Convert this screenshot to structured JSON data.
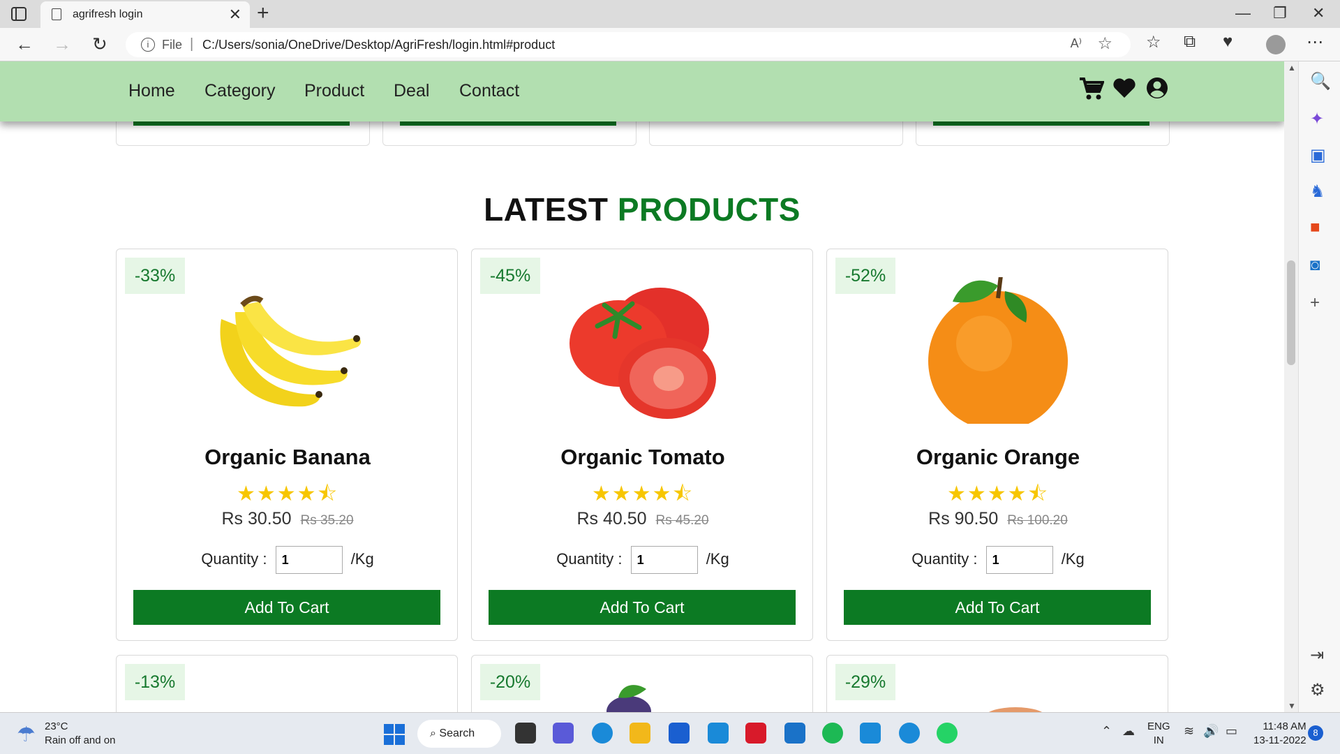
{
  "browser": {
    "tab_title": "agrifresh login",
    "url_scheme": "File",
    "url_path": "C:/Users/sonia/OneDrive/Desktop/AgriFresh/login.html#product"
  },
  "header": {
    "menu": [
      "Home",
      "Category",
      "Product",
      "Deal",
      "Contact"
    ],
    "icons": [
      "cart-icon",
      "heart-icon",
      "user-icon"
    ]
  },
  "section": {
    "title_dark": "LATEST",
    "title_green": "PRODUCTS"
  },
  "products": [
    {
      "name": "Organic Banana",
      "discount": "-33%",
      "price": "Rs 30.50",
      "old_price": "Rs 35.20",
      "rating": 4.5,
      "stars": "★★★★⯪",
      "qty_label": "Quantity :",
      "qty": "1",
      "unit": "/Kg",
      "button": "Add To Cart",
      "image": "banana-image"
    },
    {
      "name": "Organic Tomato",
      "discount": "-45%",
      "price": "Rs 40.50",
      "old_price": "Rs 45.20",
      "rating": 4.5,
      "stars": "★★★★⯪",
      "qty_label": "Quantity :",
      "qty": "1",
      "unit": "/Kg",
      "button": "Add To Cart",
      "image": "tomato-image"
    },
    {
      "name": "Organic Orange",
      "discount": "-52%",
      "price": "Rs 90.50",
      "old_price": "Rs 100.20",
      "rating": 4.5,
      "stars": "★★★★⯪",
      "qty_label": "Quantity :",
      "qty": "1",
      "unit": "/Kg",
      "button": "Add To Cart",
      "image": "orange-image"
    }
  ],
  "next_row_discounts": [
    "-13%",
    "-20%",
    "-29%"
  ],
  "taskbar": {
    "temp": "23°C",
    "weather": "Rain off and on",
    "search": "Search",
    "lang_1": "ENG",
    "lang_2": "IN",
    "time": "11:48 AM",
    "date": "13-11-2022",
    "notif_count": "8"
  },
  "colors": {
    "header_bg": "#b2dfb0",
    "brand_green": "#0c7a23",
    "badge_bg": "#e6f6e6",
    "star": "#f7c600"
  }
}
